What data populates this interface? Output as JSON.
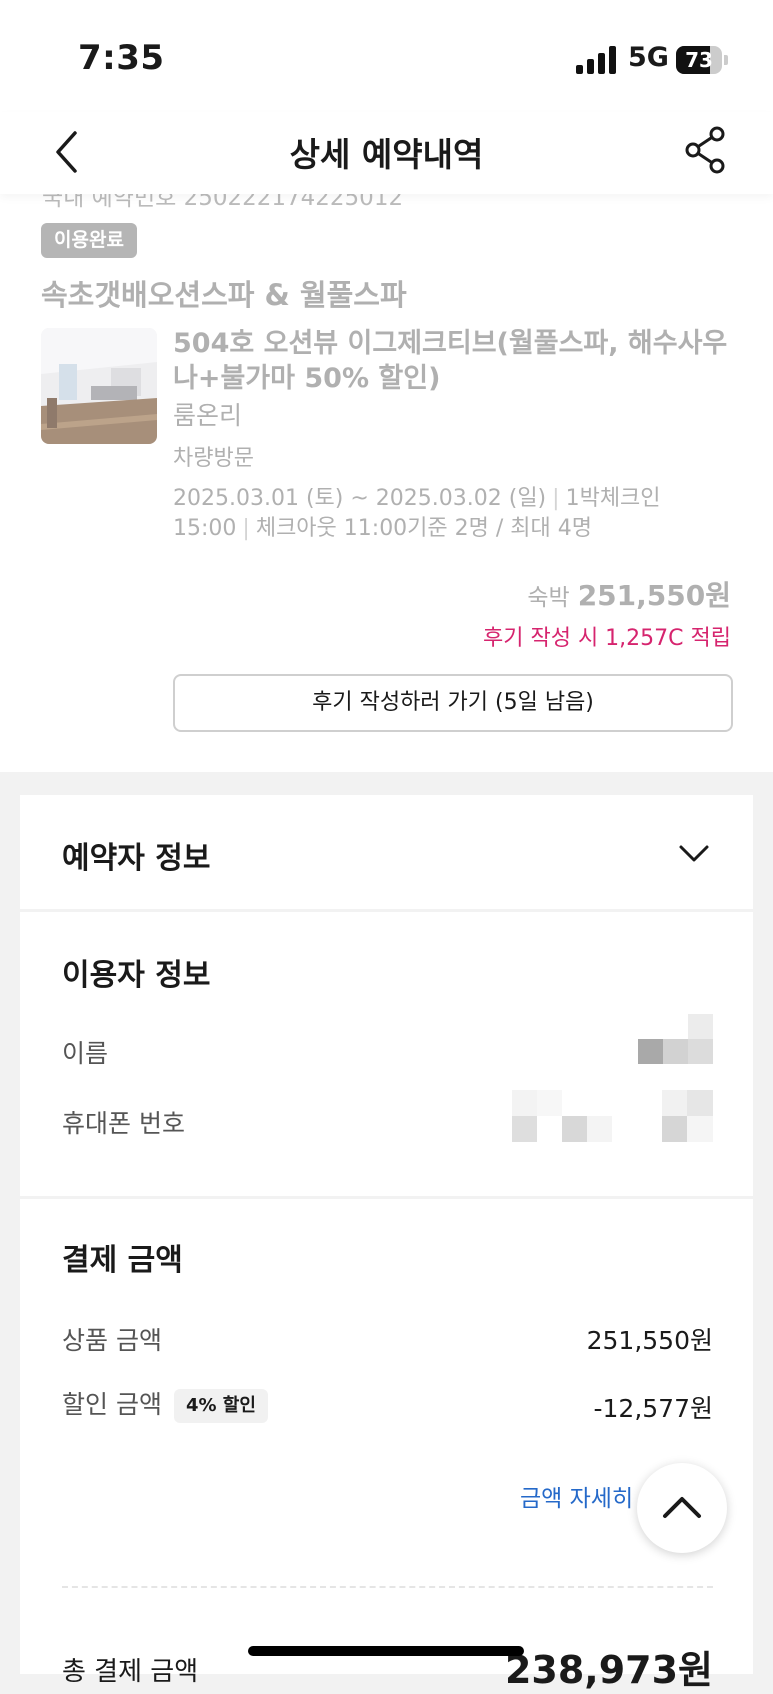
{
  "status_bar": {
    "time": "7:35",
    "network": "5G",
    "battery": "73",
    "battery_level": 0.73
  },
  "header": {
    "title": "상세 예약내역",
    "back_icon": "chevron-left-icon",
    "share_icon": "share-icon"
  },
  "reservation": {
    "cut_off_text": "국내 예약번호 250222174225012",
    "status_badge": "이용완료",
    "hotel_name": "속초갯배오션스파 & 월풀스파",
    "room_name": "504호 오션뷰 이그제크티브(월풀스파, 해수사우나+불가마 50% 할인)",
    "room_type": "룸온리",
    "visit_method": "차량방문",
    "date_range": "2025.03.01 (토) ~ 2025.03.02 (일)",
    "nights_checkin": "1박체크인",
    "checkin_time": "15:00",
    "checkout": "체크아웃 11:00기준 2명 / 최대 4명",
    "price_label": "숙박",
    "price_value": "251,550원",
    "review_point": "후기 작성 시 1,257C 적립",
    "review_button": "후기 작성하러 가기 (5일 남음)"
  },
  "booker_section": {
    "title": "예약자 정보",
    "toggle_icon": "chevron-down-icon"
  },
  "user_section": {
    "title": "이용자 정보",
    "name_label": "이름",
    "phone_label": "휴대폰 번호"
  },
  "payment_section": {
    "title": "결제 금액",
    "product_label": "상품 금액",
    "product_value": "251,550원",
    "discount_label": "할인 금액",
    "discount_badge": "4% 할인",
    "discount_value": "-12,577원",
    "detail_link": "금액 자세히 보기",
    "total_label": "총 결제 금액",
    "total_value": "238,973원"
  },
  "floating": {
    "scroll_top_icon": "chevron-up-icon"
  },
  "colors": {
    "accent_pink": "#d6246e",
    "link_blue": "#2569c9",
    "badge_gray": "#b5b5b5"
  }
}
